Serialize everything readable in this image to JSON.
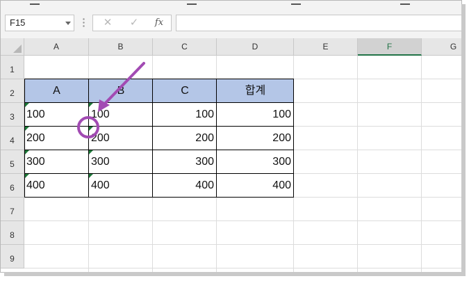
{
  "formula_bar": {
    "name_box": "F15",
    "cancel_icon": "✕",
    "enter_icon": "✓",
    "fx_label": "fx",
    "formula_value": ""
  },
  "columns": [
    "A",
    "B",
    "C",
    "D",
    "E",
    "F",
    "G"
  ],
  "selected_column": "F",
  "rows": [
    "1",
    "2",
    "3",
    "4",
    "5",
    "6",
    "7",
    "8",
    "9"
  ],
  "table": {
    "header": [
      "A",
      "B",
      "C",
      "합계"
    ],
    "body": [
      [
        "100",
        "100",
        "100",
        "100"
      ],
      [
        "200",
        "200",
        "200",
        "200"
      ],
      [
        "300",
        "300",
        "300",
        "300"
      ],
      [
        "400",
        "400",
        "400",
        "400"
      ]
    ]
  },
  "colors": {
    "header_fill": "#b4c6e7",
    "annotation": "#a24bb3",
    "text_number_flag": "#1e7a39",
    "excel_green": "#217346"
  }
}
